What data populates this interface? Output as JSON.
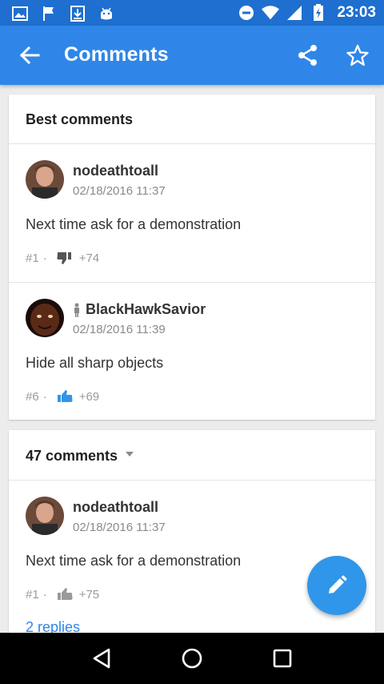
{
  "status_bar": {
    "time": "23:03",
    "left_icons": [
      "image-icon",
      "flag-icon",
      "download-icon",
      "android-icon"
    ],
    "right_icons": [
      "do-not-disturb-icon",
      "wifi-icon",
      "signal-icon",
      "battery-charging-icon"
    ]
  },
  "toolbar": {
    "title": "Comments",
    "background": "#2f86e8"
  },
  "best_comments": {
    "header": "Best comments",
    "comments": [
      {
        "author": "nodeathtoall",
        "date": "02/18/2016 11:37",
        "text": "Next time ask for a demonstration",
        "number": "#1",
        "vote_icon": "thumb-down-icon",
        "score": "+74"
      },
      {
        "author": "BlackHawkSavior",
        "date": "02/18/2016 11:39",
        "text": "Hide all sharp objects",
        "number": "#6",
        "vote_icon": "thumb-up-icon",
        "score": "+69"
      }
    ]
  },
  "all_comments": {
    "header": "47 comments",
    "comments": [
      {
        "author": "nodeathtoall",
        "date": "02/18/2016 11:37",
        "text": "Next time ask for a demonstration",
        "number": "#1",
        "vote_icon": "thumb-up-icon",
        "score": "+75",
        "replies": "2 replies"
      }
    ]
  },
  "colors": {
    "accent": "#2f86e8",
    "status_bar": "#1e6fcf",
    "fab": "#2f96ea",
    "thumb_up_active": "#2f96ea"
  }
}
